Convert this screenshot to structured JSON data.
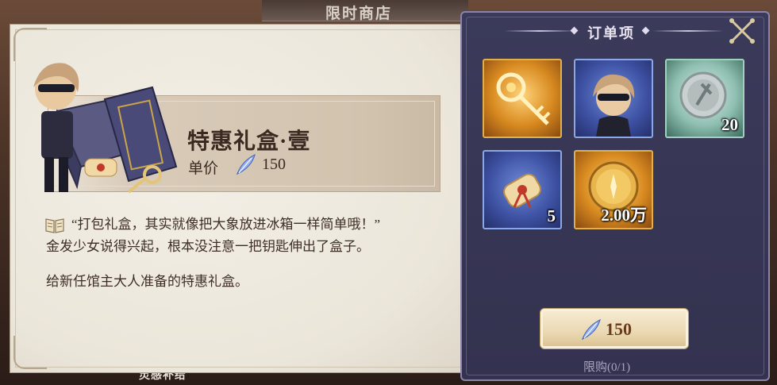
{
  "background": {
    "top_title": "限时商店",
    "bottom_label": "灵感补给"
  },
  "item": {
    "title": "特惠礼盒·壹",
    "price_label": "单价",
    "price_value": "150",
    "currency_icon": "feather-crystal-icon"
  },
  "description": {
    "line1": "“打包礼盒，其实就像把大象放进冰箱一样简单哦！”",
    "line2": "金发少女说得兴起，根本没注意一把钥匙伸出了盒子。",
    "line3": "给新任馆主大人准备的特惠礼盒。"
  },
  "order_panel": {
    "title": "订单项",
    "items": [
      {
        "icon": "golden-key-icon",
        "quantity": ""
      },
      {
        "icon": "masked-character-portrait-icon",
        "quantity": ""
      },
      {
        "icon": "silver-seal-icon",
        "quantity": "20"
      },
      {
        "icon": "scroll-icon",
        "quantity": "5"
      },
      {
        "icon": "gold-coin-icon",
        "quantity": "2.00万"
      }
    ],
    "buy_price": "150",
    "limit": "限购(0/1)"
  },
  "colors": {
    "parchment": "#ebe6da",
    "panel": "#33324f",
    "button": "#ead8b2",
    "text_dark": "#3a2a22"
  }
}
